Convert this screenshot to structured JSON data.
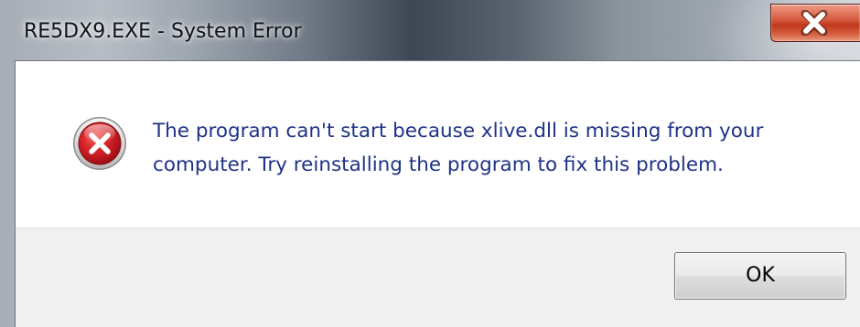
{
  "window": {
    "title": "RE5DX9.EXE - System Error"
  },
  "controls": {
    "close_icon": "close-icon"
  },
  "dialog": {
    "icon": "error-icon",
    "message_line_1": "The program can't start because xlive.dll is missing from your",
    "message_line_2": "computer. Try reinstalling the program to fix this problem."
  },
  "buttons": {
    "ok_label": "OK"
  },
  "colors": {
    "message_text": "#1e3287",
    "close_button_red": "#c0381d",
    "error_icon_red": "#c8141a",
    "button_area_bg": "#f0f0f0"
  }
}
